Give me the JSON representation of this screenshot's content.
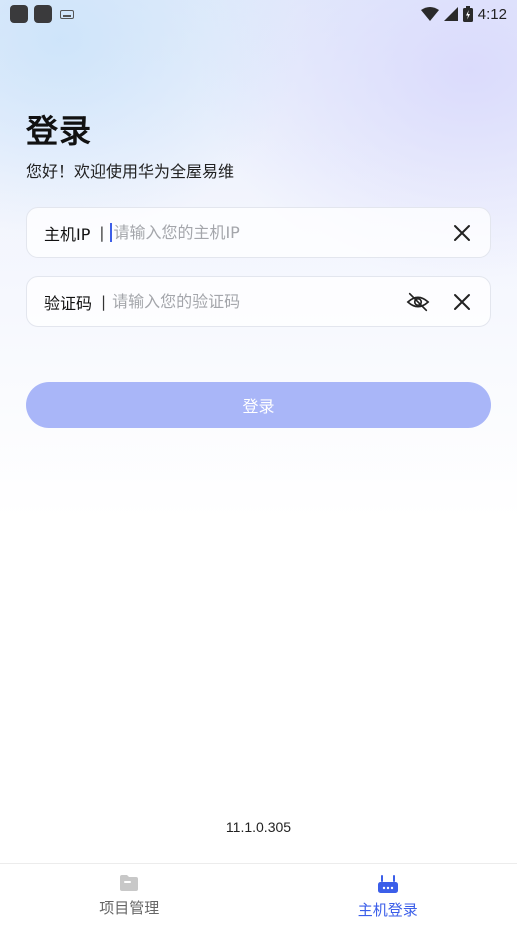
{
  "status_bar": {
    "time": "4:12"
  },
  "login": {
    "title": "登录",
    "subtitle": "您好！欢迎使用华为全屋易维",
    "host_field": {
      "label": "主机IP",
      "separator": "|",
      "value": "",
      "placeholder": "请输入您的主机IP"
    },
    "code_field": {
      "label": "验证码",
      "separator": "|",
      "value": "",
      "placeholder": "请输入您的验证码"
    },
    "login_button_label": "登录"
  },
  "version": "11.1.0.305",
  "tab_bar": {
    "tabs": [
      {
        "label": "项目管理",
        "icon": "folder-icon",
        "active": false
      },
      {
        "label": "主机登录",
        "icon": "router-icon",
        "active": true
      }
    ]
  },
  "colors": {
    "accent": "#3b5ee9",
    "button_disabled": "#a9b6f8",
    "placeholder": "#a4a6ab"
  }
}
